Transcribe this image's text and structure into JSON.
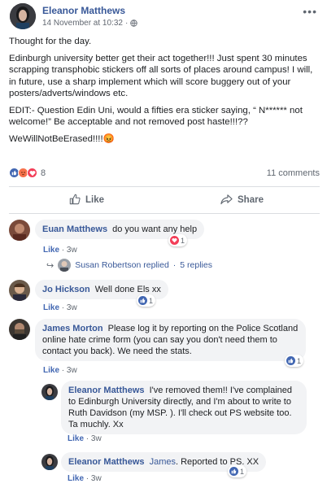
{
  "post": {
    "author": "Eleanor Matthews",
    "timestamp": "14 November at 10:32",
    "dot": "·",
    "paragraphs": [
      "Thought for the day.",
      "Edinburgh university better get their act together!!! Just spent 30 minutes scrapping transphobic stickers off all sorts of places around campus! I will, in future, use a sharp implement which will score buggery out of your posters/adverts/windows etc.",
      "EDIT:- Question Edin Uni, would a fifties era sticker saying, “ N****** not welcome!” Be acceptable and not removed post haste!!!??",
      "WeWillNotBeErased!!!!😡"
    ],
    "reaction_count": "8",
    "comment_count": "11 comments"
  },
  "actions": {
    "like": "Like",
    "share": "Share"
  },
  "comments": [
    {
      "name": "Euan Matthews",
      "text": "do you want any help",
      "like": "Like",
      "sep": "·",
      "age": "3w",
      "react_count": "1"
    },
    {
      "replier": "Susan Robertson replied",
      "sep": "·",
      "replies": "5 replies"
    },
    {
      "name": "Jo Hickson",
      "text": "Well done Els xx",
      "like": "Like",
      "sep": "·",
      "age": "3w",
      "react_count": "1"
    },
    {
      "name": "James Morton",
      "text": "Please log it by reporting on the Police Scotland online hate crime form (you can say you don't need them to contact you back). We need the stats.",
      "like": "Like",
      "sep": "·",
      "age": "3w",
      "react_count": "1"
    },
    {
      "name": "Eleanor Matthews",
      "text": "I've removed them!! I've complained to Edinburgh University directly, and I'm about to write to Ruth Davidson (my MSP. ). I'll check out PS website too. Ta muchly. Xx",
      "like": "Like",
      "sep": "·",
      "age": "3w"
    },
    {
      "name": "Eleanor Matthews",
      "mention": "James",
      "text": ". Reported to PS. XX",
      "like": "Like",
      "sep": "·",
      "age": "3w",
      "react_count": "1"
    }
  ],
  "colors": {
    "link": "#385898",
    "like_blue": "#4267b2",
    "love_red": "#f33e58",
    "angry_orange": "#f7714b",
    "bubble": "#f2f3f5"
  },
  "icons": [
    "globe-icon",
    "more-icon",
    "like-icon",
    "share-icon",
    "reply-arrow-icon",
    "thumbs-up-reaction-icon",
    "love-reaction-icon",
    "angry-reaction-icon"
  ]
}
